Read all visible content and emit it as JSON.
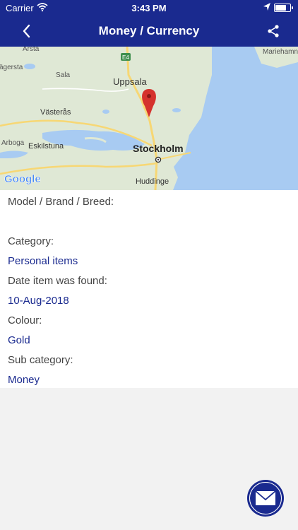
{
  "status_bar": {
    "carrier": "Carrier",
    "time": "3:43 PM",
    "battery_level": 0.85
  },
  "nav": {
    "title": "Money / Currency"
  },
  "map": {
    "places": {
      "arsta": "Årsta",
      "agersta": "ägersta",
      "sala": "Sala",
      "uppsala": "Uppsala",
      "e4": "E4",
      "vasteras": "Västerås",
      "arboga": "Arboga",
      "eskilstuna": "Eskilstuna",
      "stockholm": "Stockholm",
      "huddinge": "Huddinge",
      "mariehamn": "Mariehamn"
    },
    "attribution": "Google",
    "colors": {
      "land": "#dfe8d5",
      "water": "#a8cbf2",
      "road": "#f7d774",
      "pin": "#d5322d"
    }
  },
  "details": [
    {
      "label": "Model / Brand / Breed:",
      "value": ""
    },
    {
      "label": "Category:",
      "value": "Personal items"
    },
    {
      "label": "Date item was found:",
      "value": "10-Aug-2018"
    },
    {
      "label": "Colour:",
      "value": "Gold"
    },
    {
      "label": "Sub category:",
      "value": "Money"
    }
  ],
  "colors": {
    "primary": "#1a2a8f",
    "label": "#444444",
    "background": "#f2f2f2"
  }
}
